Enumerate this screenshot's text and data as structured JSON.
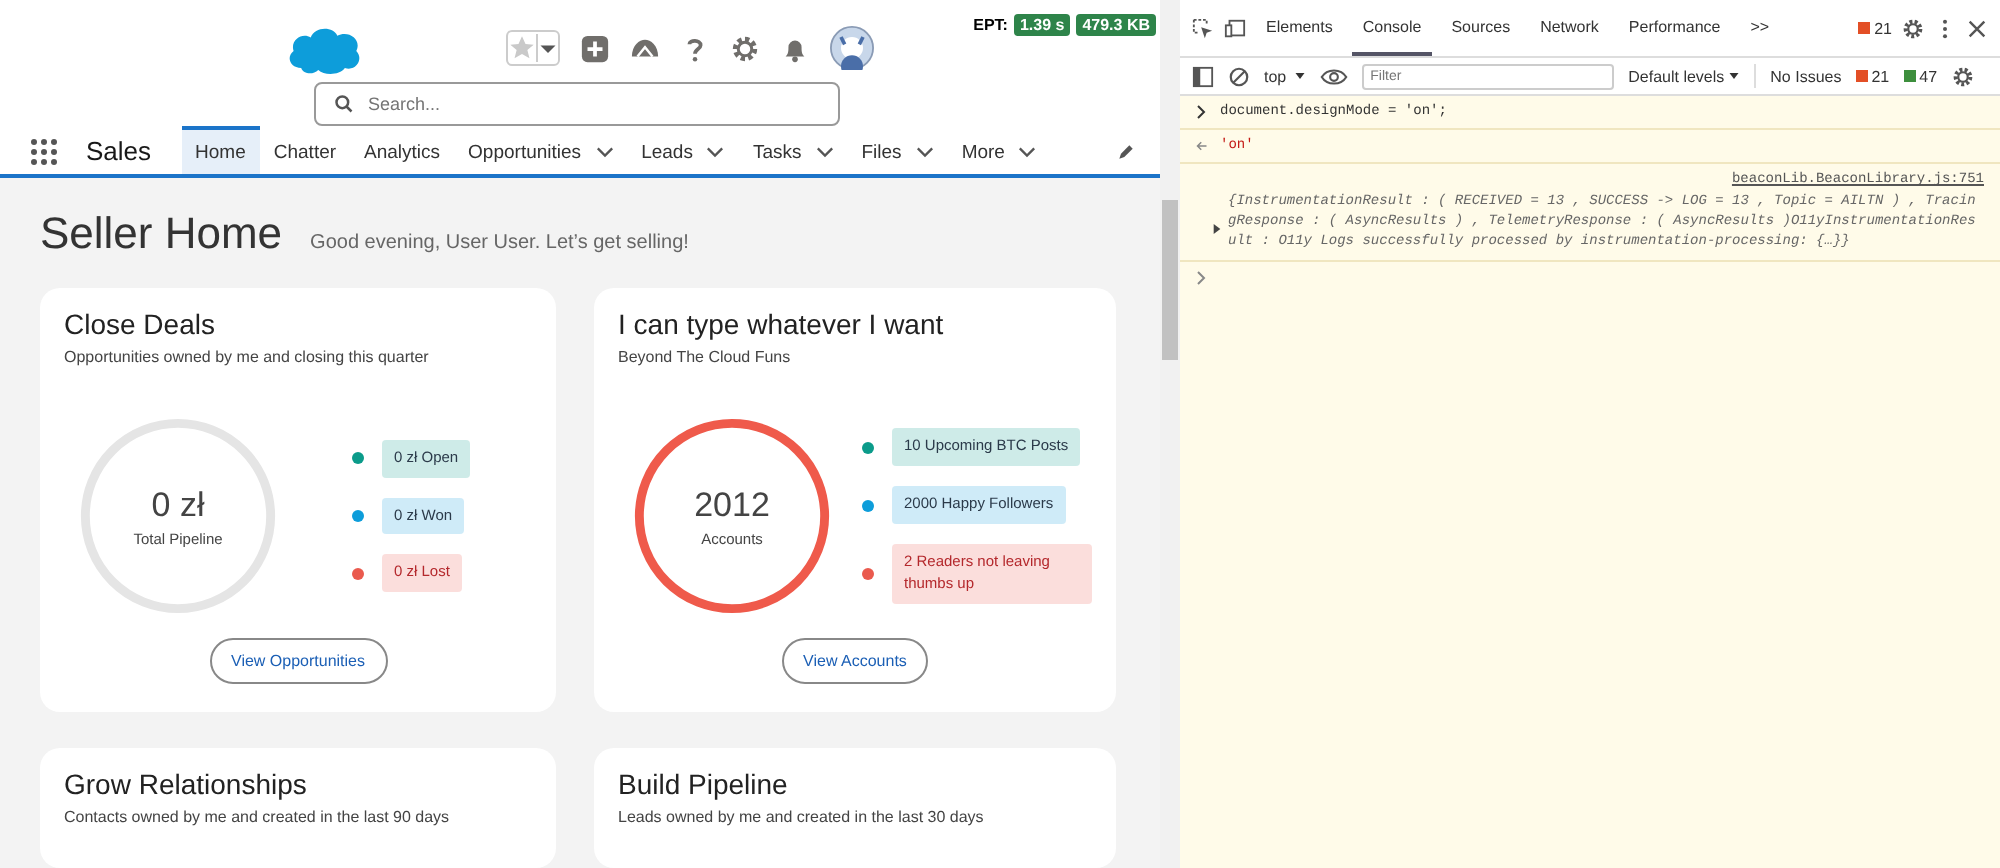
{
  "header": {
    "ept_label": "EPT:",
    "ept_time": "1.39 s",
    "ept_size": "479.3 KB",
    "search": {
      "placeholder": "Search..."
    }
  },
  "nav": {
    "app_name": "Sales",
    "tabs": [
      {
        "label": "Home",
        "selected": true,
        "dropdown": false
      },
      {
        "label": "Chatter",
        "selected": false,
        "dropdown": false
      },
      {
        "label": "Analytics",
        "selected": false,
        "dropdown": false
      },
      {
        "label": "Opportunities",
        "selected": false,
        "dropdown": true
      },
      {
        "label": "Leads",
        "selected": false,
        "dropdown": true
      },
      {
        "label": "Tasks",
        "selected": false,
        "dropdown": true
      },
      {
        "label": "Files",
        "selected": false,
        "dropdown": true
      },
      {
        "label": "More",
        "selected": false,
        "dropdown": true
      }
    ]
  },
  "page": {
    "title": "Seller Home",
    "greeting": "Good evening, User User. Let’s get selling!"
  },
  "cards": [
    {
      "title": "Close Deals",
      "subtitle": "Opportunities owned by me and closing this quarter",
      "color": "#e5e5e5",
      "center_value": "0 zł",
      "center_label": "Total Pipeline",
      "legend": [
        {
          "label": "0 zł Open",
          "color": "#0b9b8a"
        },
        {
          "label": "0 zł Won",
          "color": "#0d9dda"
        },
        {
          "label": "0 zł Lost",
          "color": "#ea5a4e"
        }
      ],
      "button": "View Opportunities"
    },
    {
      "title": "I can type whatever I want",
      "subtitle": "Beyond The Cloud Funs",
      "color": "#ef5a4b",
      "center_value": "2012",
      "center_label": "Accounts",
      "legend": [
        {
          "label": "10 Upcoming BTC Posts",
          "color": "#0b9b8a"
        },
        {
          "label": "2000 Happy Followers",
          "color": "#0d9dda"
        },
        {
          "label": "2 Readers not leaving thumbs up",
          "color": "#ea5a4e"
        }
      ],
      "button": "View Accounts"
    }
  ],
  "more_cards": [
    {
      "title": "Grow Relationships",
      "subtitle": "Contacts owned by me and created in the last 90 days"
    },
    {
      "title": "Build Pipeline",
      "subtitle": "Leads owned by me and created in the last 30 days"
    }
  ],
  "devtools": {
    "tabs": [
      {
        "label": "Elements",
        "selected": false
      },
      {
        "label": "Console",
        "selected": true
      },
      {
        "label": "Sources",
        "selected": false
      },
      {
        "label": "Network",
        "selected": false
      },
      {
        "label": "Performance",
        "selected": false
      }
    ],
    "overflow": ">>",
    "error_count": "21",
    "toolbar": {
      "context": "top",
      "filter_placeholder": "Filter",
      "levels": "Default levels",
      "issues_label": "No Issues",
      "issues_errors": "21",
      "issues_warnings": "47"
    },
    "console": [
      {
        "kind": "input",
        "text": "document.designMode = 'on';"
      },
      {
        "kind": "result",
        "text": "'on'"
      },
      {
        "kind": "log",
        "source": "beaconLib.BeaconLibrary.js:751",
        "text": "{InstrumentationResult :  ( RECEIVED = 13 , SUCCESS -> LOG = 13 , Topic = AILTN )  , TracingResponse : ( AsyncResults ) , TelemetryResponse : ( AsyncResults )O11yInstrumentationResult : O11y Logs successfully processed by instrumentation-processing: {…}}"
      },
      {
        "kind": "prompt"
      }
    ]
  }
}
